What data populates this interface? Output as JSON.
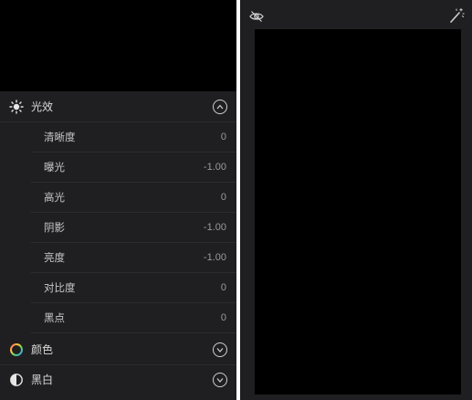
{
  "light_section": {
    "title": "光效",
    "icon": "sun-icon",
    "state": "expanded",
    "items": [
      {
        "label": "清晰度",
        "value": "0"
      },
      {
        "label": "曝光",
        "value": "-1.00"
      },
      {
        "label": "高光",
        "value": "0"
      },
      {
        "label": "阴影",
        "value": "-1.00"
      },
      {
        "label": "亮度",
        "value": "-1.00"
      },
      {
        "label": "对比度",
        "value": "0"
      },
      {
        "label": "黑点",
        "value": "0"
      }
    ]
  },
  "color_section": {
    "title": "颜色",
    "icon": "color-wheel-icon",
    "state": "collapsed"
  },
  "bw_section": {
    "title": "黑白",
    "icon": "half-circle-icon",
    "state": "collapsed"
  },
  "toolbar": {
    "visibility_icon": "eye-slash-icon",
    "auto_enhance_icon": "magic-wand-icon"
  }
}
